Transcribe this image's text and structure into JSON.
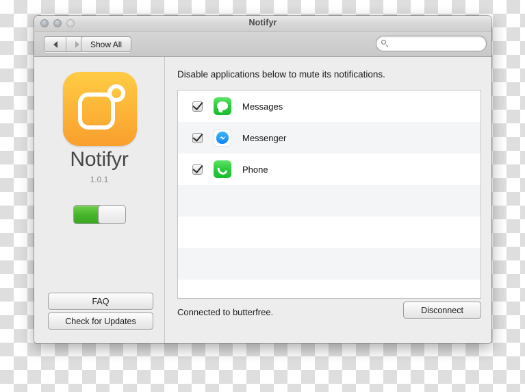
{
  "window": {
    "title": "Notifyr",
    "traffic_lights": [
      "close",
      "minimize",
      "zoom"
    ]
  },
  "toolbar": {
    "back_label": "◀",
    "forward_label": "▶",
    "show_all_label": "Show All",
    "search": {
      "value": "",
      "placeholder": "",
      "icon": "search-icon"
    }
  },
  "sidebar": {
    "app_icon": "notifyr-app-icon",
    "app_name": "Notifyr",
    "version": "1.0.1",
    "toggle": {
      "state": "on",
      "label": "enable-notifyr-toggle"
    },
    "buttons": [
      {
        "label": "FAQ",
        "name": "faq-button"
      },
      {
        "label": "Check for Updates",
        "name": "check-for-updates-button"
      }
    ]
  },
  "main": {
    "heading": "Disable applications below to mute its notifications.",
    "apps": [
      {
        "name": "Messages",
        "checked": true,
        "icon": "messages-app-icon"
      },
      {
        "name": "Messenger",
        "checked": true,
        "icon": "messenger-app-icon"
      },
      {
        "name": "Phone",
        "checked": true,
        "icon": "phone-app-icon"
      }
    ],
    "status_text": "Connected to butterfree.",
    "disconnect_label": "Disconnect"
  },
  "colors": {
    "accent_orange": "#fdb839",
    "toggle_green": "#46b52a",
    "messages_green": "#2ecb3f",
    "messenger_blue": "#0d87f5",
    "window_chrome": "#ececec",
    "list_stripe": "#f4f5f7"
  }
}
